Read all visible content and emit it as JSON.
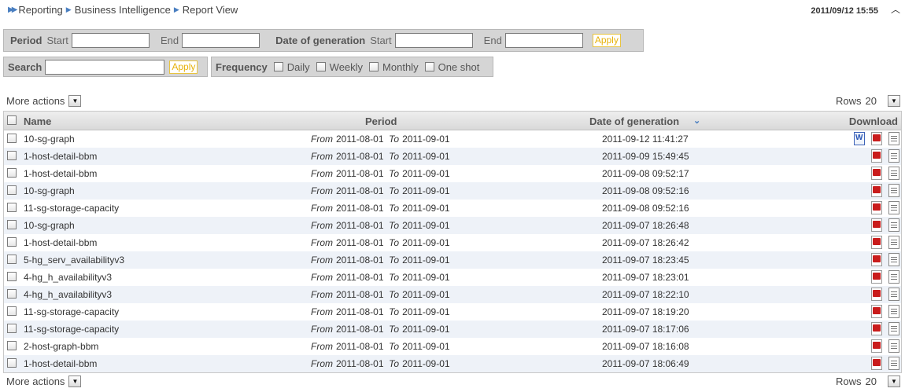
{
  "breadcrumb": [
    "Reporting",
    "Business Intelligence",
    "Report View"
  ],
  "header": {
    "datetime": "2011/09/12 15:55"
  },
  "period_filter": {
    "label": "Period",
    "start_label": "Start",
    "start_value": "",
    "end_label": "End",
    "end_value": "",
    "gen_label": "Date of generation",
    "gen_start_label": "Start",
    "gen_start_value": "",
    "gen_end_label": "End",
    "gen_end_value": "",
    "apply_label": "Apply"
  },
  "search_filter": {
    "label": "Search",
    "value": "",
    "apply_label": "Apply"
  },
  "frequency_filter": {
    "label": "Frequency",
    "options": [
      "Daily",
      "Weekly",
      "Monthly",
      "One shot"
    ]
  },
  "actions": {
    "more_actions_label": "More actions",
    "rows_label": "Rows",
    "rows_value": "20"
  },
  "table": {
    "columns": {
      "name": "Name",
      "period": "Period",
      "date": "Date of generation",
      "download": "Download"
    },
    "from_label": "From",
    "to_label": "To",
    "rows": [
      {
        "name": "10-sg-graph",
        "from": "2011-08-01",
        "to": "2011-09-01",
        "date": "2011-09-12 11:41:27",
        "formats": [
          "word",
          "pdf",
          "txt"
        ]
      },
      {
        "name": "1-host-detail-bbm",
        "from": "2011-08-01",
        "to": "2011-09-01",
        "date": "2011-09-09 15:49:45",
        "formats": [
          "pdf",
          "txt"
        ]
      },
      {
        "name": "1-host-detail-bbm",
        "from": "2011-08-01",
        "to": "2011-09-01",
        "date": "2011-09-08 09:52:17",
        "formats": [
          "pdf",
          "txt"
        ]
      },
      {
        "name": "10-sg-graph",
        "from": "2011-08-01",
        "to": "2011-09-01",
        "date": "2011-09-08 09:52:16",
        "formats": [
          "pdf",
          "txt"
        ]
      },
      {
        "name": "11-sg-storage-capacity",
        "from": "2011-08-01",
        "to": "2011-09-01",
        "date": "2011-09-08 09:52:16",
        "formats": [
          "pdf",
          "txt"
        ]
      },
      {
        "name": "10-sg-graph",
        "from": "2011-08-01",
        "to": "2011-09-01",
        "date": "2011-09-07 18:26:48",
        "formats": [
          "pdf",
          "txt"
        ]
      },
      {
        "name": "1-host-detail-bbm",
        "from": "2011-08-01",
        "to": "2011-09-01",
        "date": "2011-09-07 18:26:42",
        "formats": [
          "pdf",
          "txt"
        ]
      },
      {
        "name": "5-hg_serv_availabilityv3",
        "from": "2011-08-01",
        "to": "2011-09-01",
        "date": "2011-09-07 18:23:45",
        "formats": [
          "pdf",
          "txt"
        ]
      },
      {
        "name": "4-hg_h_availabilityv3",
        "from": "2011-08-01",
        "to": "2011-09-01",
        "date": "2011-09-07 18:23:01",
        "formats": [
          "pdf",
          "txt"
        ]
      },
      {
        "name": "4-hg_h_availabilityv3",
        "from": "2011-08-01",
        "to": "2011-09-01",
        "date": "2011-09-07 18:22:10",
        "formats": [
          "pdf",
          "txt"
        ]
      },
      {
        "name": "11-sg-storage-capacity",
        "from": "2011-08-01",
        "to": "2011-09-01",
        "date": "2011-09-07 18:19:20",
        "formats": [
          "pdf",
          "txt"
        ]
      },
      {
        "name": "11-sg-storage-capacity",
        "from": "2011-08-01",
        "to": "2011-09-01",
        "date": "2011-09-07 18:17:06",
        "formats": [
          "pdf",
          "txt"
        ]
      },
      {
        "name": "2-host-graph-bbm",
        "from": "2011-08-01",
        "to": "2011-09-01",
        "date": "2011-09-07 18:16:08",
        "formats": [
          "pdf",
          "txt"
        ]
      },
      {
        "name": "1-host-detail-bbm",
        "from": "2011-08-01",
        "to": "2011-09-01",
        "date": "2011-09-07 18:06:49",
        "formats": [
          "pdf",
          "txt"
        ]
      }
    ]
  },
  "colors": {
    "accent": "#4a7fc1",
    "apply": "#e7b20a",
    "panel": "#d5d5d5",
    "row_alt": "#eef2f8",
    "pdf": "#c91c1c"
  }
}
